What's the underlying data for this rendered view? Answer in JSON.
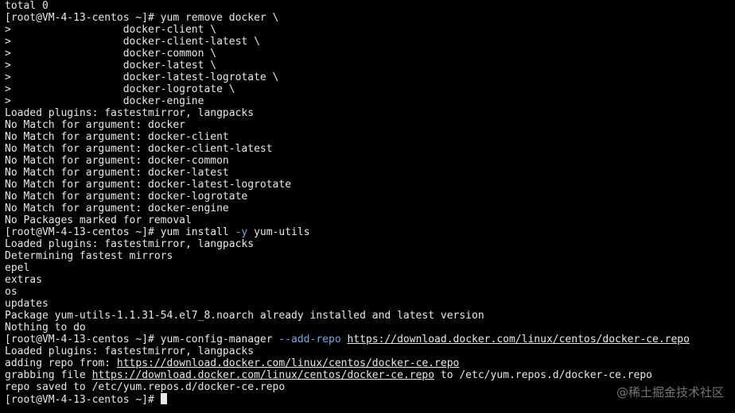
{
  "terminal": {
    "lines": [
      [
        {
          "t": "total 0"
        }
      ],
      [
        {
          "t": "[root@VM-4-13-centos ~]# yum remove docker \\"
        }
      ],
      [
        {
          "t": ">                  docker-client \\"
        }
      ],
      [
        {
          "t": ">                  docker-client-latest \\"
        }
      ],
      [
        {
          "t": ">                  docker-common \\"
        }
      ],
      [
        {
          "t": ">                  docker-latest \\"
        }
      ],
      [
        {
          "t": ">                  docker-latest-logrotate \\"
        }
      ],
      [
        {
          "t": ">                  docker-logrotate \\"
        }
      ],
      [
        {
          "t": ">                  docker-engine"
        }
      ],
      [
        {
          "t": "Loaded plugins: fastestmirror, langpacks"
        }
      ],
      [
        {
          "t": "No Match for argument: docker"
        }
      ],
      [
        {
          "t": "No Match for argument: docker-client"
        }
      ],
      [
        {
          "t": "No Match for argument: docker-client-latest"
        }
      ],
      [
        {
          "t": "No Match for argument: docker-common"
        }
      ],
      [
        {
          "t": "No Match for argument: docker-latest"
        }
      ],
      [
        {
          "t": "No Match for argument: docker-latest-logrotate"
        }
      ],
      [
        {
          "t": "No Match for argument: docker-logrotate"
        }
      ],
      [
        {
          "t": "No Match for argument: docker-engine"
        }
      ],
      [
        {
          "t": "No Packages marked for removal"
        }
      ],
      [
        {
          "t": "[root@VM-4-13-centos ~]# yum install "
        },
        {
          "t": "-y",
          "k": "flag"
        },
        {
          "t": " yum-utils"
        }
      ],
      [
        {
          "t": "Loaded plugins: fastestmirror, langpacks"
        }
      ],
      [
        {
          "t": "Determining fastest mirrors"
        }
      ],
      [
        {
          "t": "epel"
        }
      ],
      [
        {
          "t": "extras"
        }
      ],
      [
        {
          "t": "os"
        }
      ],
      [
        {
          "t": "updates"
        }
      ],
      [
        {
          "t": "Package yum-utils-1.1.31-54.el7_8.noarch already installed and latest version"
        }
      ],
      [
        {
          "t": "Nothing to do"
        }
      ],
      [
        {
          "t": "[root@VM-4-13-centos ~]# yum-config-manager "
        },
        {
          "t": "--add-repo",
          "k": "flag"
        },
        {
          "t": " "
        },
        {
          "t": "https://download.docker.com/linux/centos/docker-ce.repo",
          "k": "link"
        }
      ],
      [
        {
          "t": "Loaded plugins: fastestmirror, langpacks"
        }
      ],
      [
        {
          "t": "adding repo from: "
        },
        {
          "t": "https://download.docker.com/linux/centos/docker-ce.repo",
          "k": "link"
        }
      ],
      [
        {
          "t": "grabbing file "
        },
        {
          "t": "https://download.docker.com/linux/centos/docker-ce.repo",
          "k": "link"
        },
        {
          "t": " to /etc/yum.repos.d/docker-ce.repo"
        }
      ],
      [
        {
          "t": "repo saved to /etc/yum.repos.d/docker-ce.repo"
        }
      ],
      [
        {
          "t": "[root@VM-4-13-centos ~]# "
        },
        {
          "k": "cursor"
        }
      ]
    ]
  },
  "watermark": {
    "text": "@稀土掘金技术社区"
  },
  "colors": {
    "background": "#000000",
    "text": "#e8e8e8",
    "flag": "#6ea8e8",
    "watermark": "#8a8a8a"
  }
}
